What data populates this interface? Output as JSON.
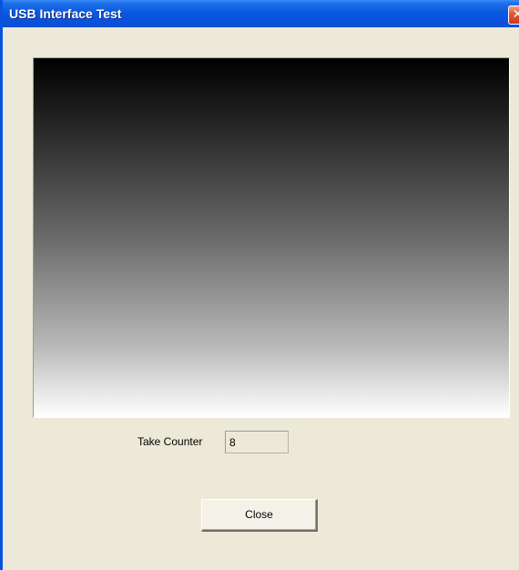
{
  "window": {
    "title": "USB Interface Test",
    "close_glyph": "✕"
  },
  "display": {
    "description_icon": "gradient-image"
  },
  "counter": {
    "label": "Take Counter",
    "value": "8"
  },
  "buttons": {
    "close_label": "Close"
  },
  "colors": {
    "titlebar": "#0a52dc",
    "dialog_bg": "#ece9d8",
    "close_button_red": "#e2593a"
  }
}
